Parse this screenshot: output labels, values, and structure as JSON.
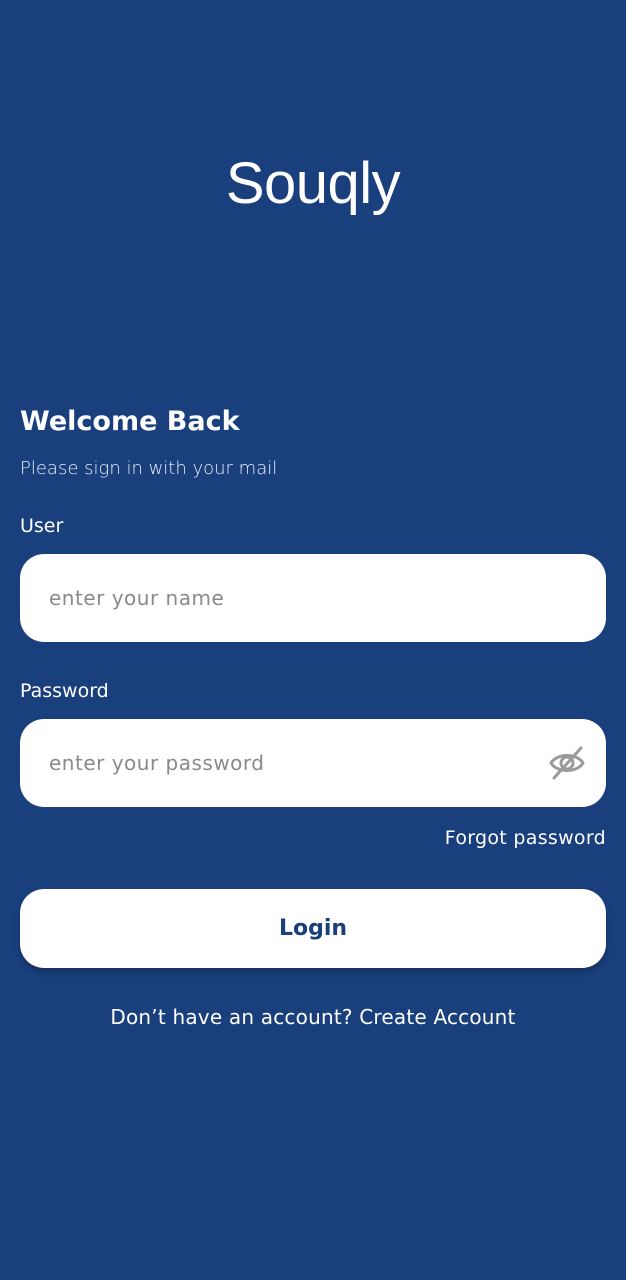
{
  "app": {
    "logo_text": "Souqly"
  },
  "header": {
    "title": "Welcome Back",
    "subtitle": "Please sign in with your mail"
  },
  "form": {
    "user_label": "User",
    "user_placeholder": "enter your name",
    "user_value": "",
    "password_label": "Password",
    "password_placeholder": "enter your password",
    "password_value": "",
    "password_toggle_icon": "eye-slash-icon",
    "forgot_password": "Forgot password",
    "login_label": "Login"
  },
  "footer": {
    "no_account_text": "Don’t have an account?",
    "create_account_link": "Create Account"
  },
  "colors": {
    "background": "#1a3f7d",
    "surface": "#ffffff",
    "placeholder": "#8a8a8a",
    "icon": "#9a9a9a"
  }
}
